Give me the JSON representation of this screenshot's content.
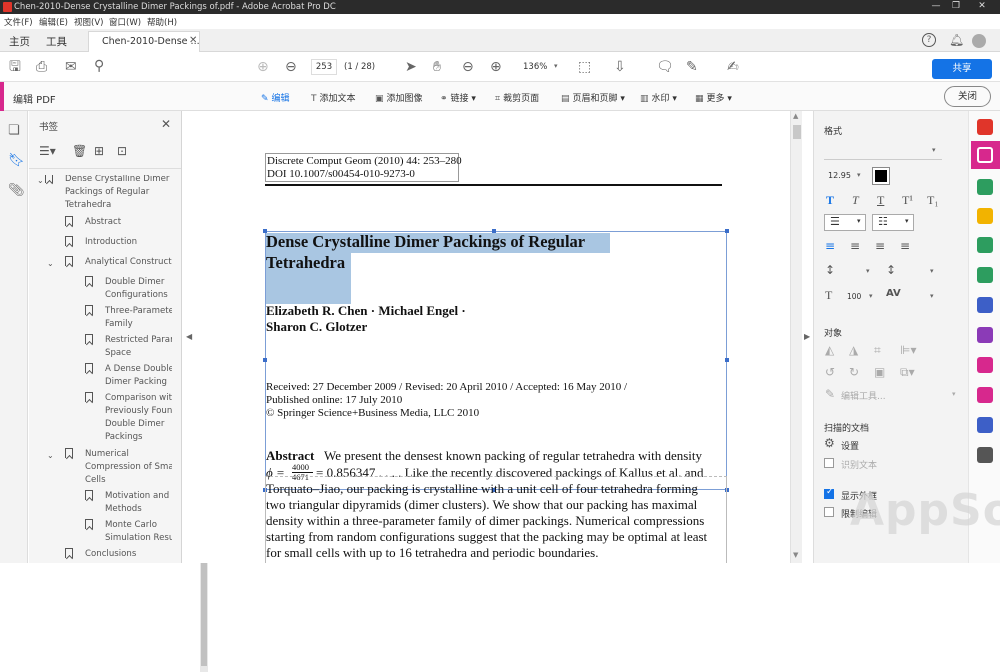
{
  "window": {
    "title": "Chen-2010-Dense Crystalline Dimer Packings of.pdf - Adobe Acrobat Pro DC"
  },
  "menu": [
    "文件(F)",
    "编辑(E)",
    "视图(V)",
    "窗口(W)",
    "帮助(H)"
  ],
  "tabs": {
    "home": "主页",
    "tools": "工具",
    "doc": "Chen-2010-Dense ..."
  },
  "toolbar": {
    "page": "253",
    "page_of": "(1 / 28)",
    "zoom": "136%",
    "share": "共享"
  },
  "editbar": {
    "title": "编辑 PDF",
    "edit": "编辑",
    "add_text": "添加文本",
    "add_image": "添加图像",
    "link": "链接",
    "crop": "裁剪页面",
    "header_footer": "页眉和页脚",
    "watermark": "水印",
    "more": "更多",
    "close": "关闭"
  },
  "bookmarks": {
    "header": "书签",
    "items": [
      {
        "text": "Dense Crystalline Dimer\nPackings of Regular\nTetrahedra"
      },
      {
        "text": "Abstract"
      },
      {
        "text": "Introduction"
      },
      {
        "text": "Analytical Construction"
      },
      {
        "text": "Double Dimer\nConfigurations"
      },
      {
        "text": "Three-Parameter\nFamily"
      },
      {
        "text": "Restricted Parameter\nSpace"
      },
      {
        "text": "A Dense Double\nDimer Packing"
      },
      {
        "text": "Comparison with\nPreviously Found\nDouble Dimer\nPackings"
      },
      {
        "text": "Numerical\nCompression of Small\nCells"
      },
      {
        "text": "Motivation and\nMethods"
      },
      {
        "text": "Monte Carlo\nSimulation Results"
      },
      {
        "text": "Conclusions"
      }
    ]
  },
  "doc": {
    "header1": "Discrete Comput Geom (2010) 44: 253–280",
    "header2": "DOI 10.1007/s00454-010-9273-0",
    "title1": "Dense Crystalline Dimer Packings of Regular",
    "title2": "Tetrahedra",
    "authors1": "Elizabeth R. Chen · Michael Engel ·",
    "authors2": "Sharon C. Glotzer",
    "received": "Received: 27 December 2009 / Revised: 20 April 2010 / Accepted: 16 May 2010 /",
    "published": "Published online: 17 July 2010",
    "copyright": "© Springer Science+Business Media, LLC 2010",
    "abstract_label": "Abstract",
    "abs1": "We present the densest known packing of regular tetrahedra with density",
    "phi": "ϕ =",
    "frac_num": "4000",
    "frac_den": "4671",
    "abs2": "= 0.856347 . . . . Like the recently discovered packings of Kallus et al. and",
    "abs3": "Torquato–Jiao, our packing is crystalline with a unit cell of four tetrahedra forming",
    "abs4": "two triangular dipyramids (dimer clusters). We show that our packing has maximal",
    "abs5": "density within a three-parameter family of dimer packings. Numerical compressions",
    "abs6": "starting from random configurations suggest that the packing may be optimal at least",
    "abs7": "for small cells with up to 16 tetrahedra and periodic boundaries."
  },
  "panel": {
    "format": "格式",
    "font_size": "12.95",
    "scale": "100",
    "objects": "对象",
    "edit_tools": "编辑工具...",
    "scanned": "扫描的文档",
    "settings": "设置",
    "recognize": "识别文本",
    "show_box": "显示外框",
    "restrict": "限制编辑"
  },
  "watermark": "AppSo",
  "colors": {
    "accent": "#d7288d",
    "blue": "#1473e6",
    "highlight": "#a9c6e2"
  }
}
